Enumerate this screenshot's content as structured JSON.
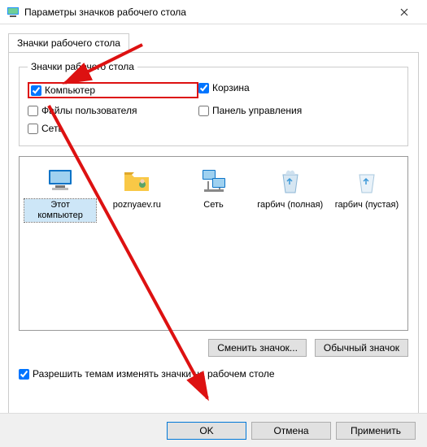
{
  "window": {
    "title": "Параметры значков рабочего стола"
  },
  "tab": {
    "label": "Значки рабочего стола"
  },
  "group": {
    "legend": "Значки рабочего стола"
  },
  "checks": {
    "computer": "Компьютер",
    "recycle": "Корзина",
    "userfiles": "Файлы пользователя",
    "cpanel": "Панель управления",
    "network": "Сеть"
  },
  "preview": {
    "thispc": "Этот компьютер",
    "user": "poznyaev.ru",
    "net": "Сеть",
    "binfull": "гарбич (полная)",
    "binempty": "гарбич (пустая)"
  },
  "buttons": {
    "change": "Сменить значок...",
    "default": "Обычный значок"
  },
  "allow": "Разрешить темам изменять значки на рабочем столе",
  "footer": {
    "ok": "OK",
    "cancel": "Отмена",
    "apply": "Применить"
  }
}
